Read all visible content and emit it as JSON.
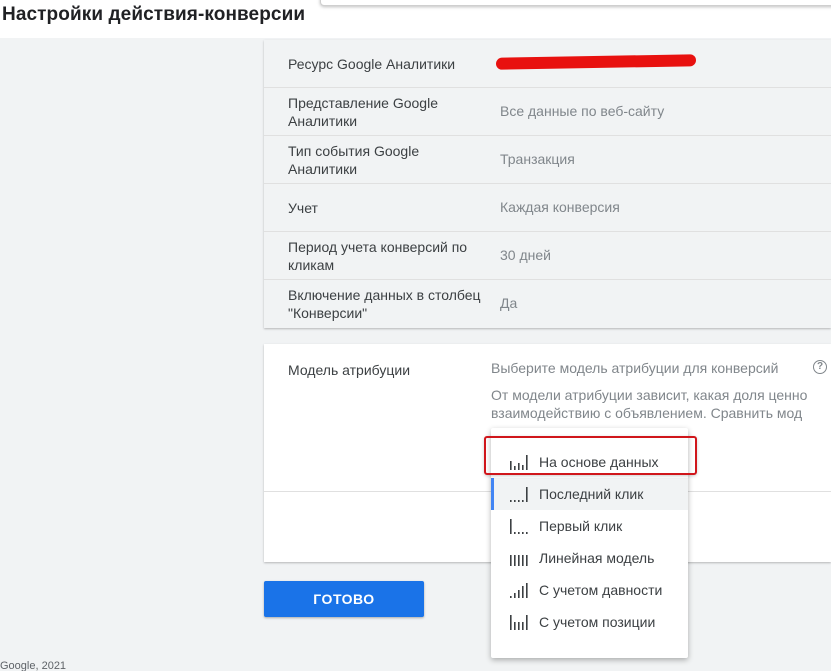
{
  "page": {
    "title": "Настройки действия-конверсии"
  },
  "settings": {
    "rows": [
      {
        "label": "Ресурс Google Аналитики",
        "value": ""
      },
      {
        "label": "Представление Google Аналитики",
        "value": "Все данные по веб-сайту"
      },
      {
        "label": "Тип события Google Аналитики",
        "value": "Транзакция"
      },
      {
        "label": "Учет",
        "value": "Каждая конверсия"
      },
      {
        "label": "Период учета конверсий по кликам",
        "value": "30 дней"
      },
      {
        "label": "Включение данных в столбец \"Конверсии\"",
        "value": "Да"
      }
    ]
  },
  "attribution": {
    "label": "Модель атрибуции",
    "hint": "Выберите модель атрибуции для конверсий",
    "description_line1": "От модели атрибуции зависит, какая доля ценно",
    "description_line2": "взаимодействию с объявлением. Сравнить мод",
    "help_icon": "help-icon",
    "options": [
      {
        "label": "На основе данных",
        "icon": "data-driven-icon",
        "selected": false
      },
      {
        "label": "Последний клик",
        "icon": "last-click-icon",
        "selected": true
      },
      {
        "label": "Первый клик",
        "icon": "first-click-icon",
        "selected": false
      },
      {
        "label": "Линейная модель",
        "icon": "linear-icon",
        "selected": false
      },
      {
        "label": "С учетом давности",
        "icon": "time-decay-icon",
        "selected": false
      },
      {
        "label": "С учетом позиции",
        "icon": "position-based-icon",
        "selected": false
      }
    ]
  },
  "actions": {
    "done_label": "ГОТОВО"
  },
  "footer": {
    "text": "Google, 2021"
  },
  "colors": {
    "accent": "#1a73e8",
    "highlight": "#d0161b",
    "redaction": "#e8110f"
  }
}
